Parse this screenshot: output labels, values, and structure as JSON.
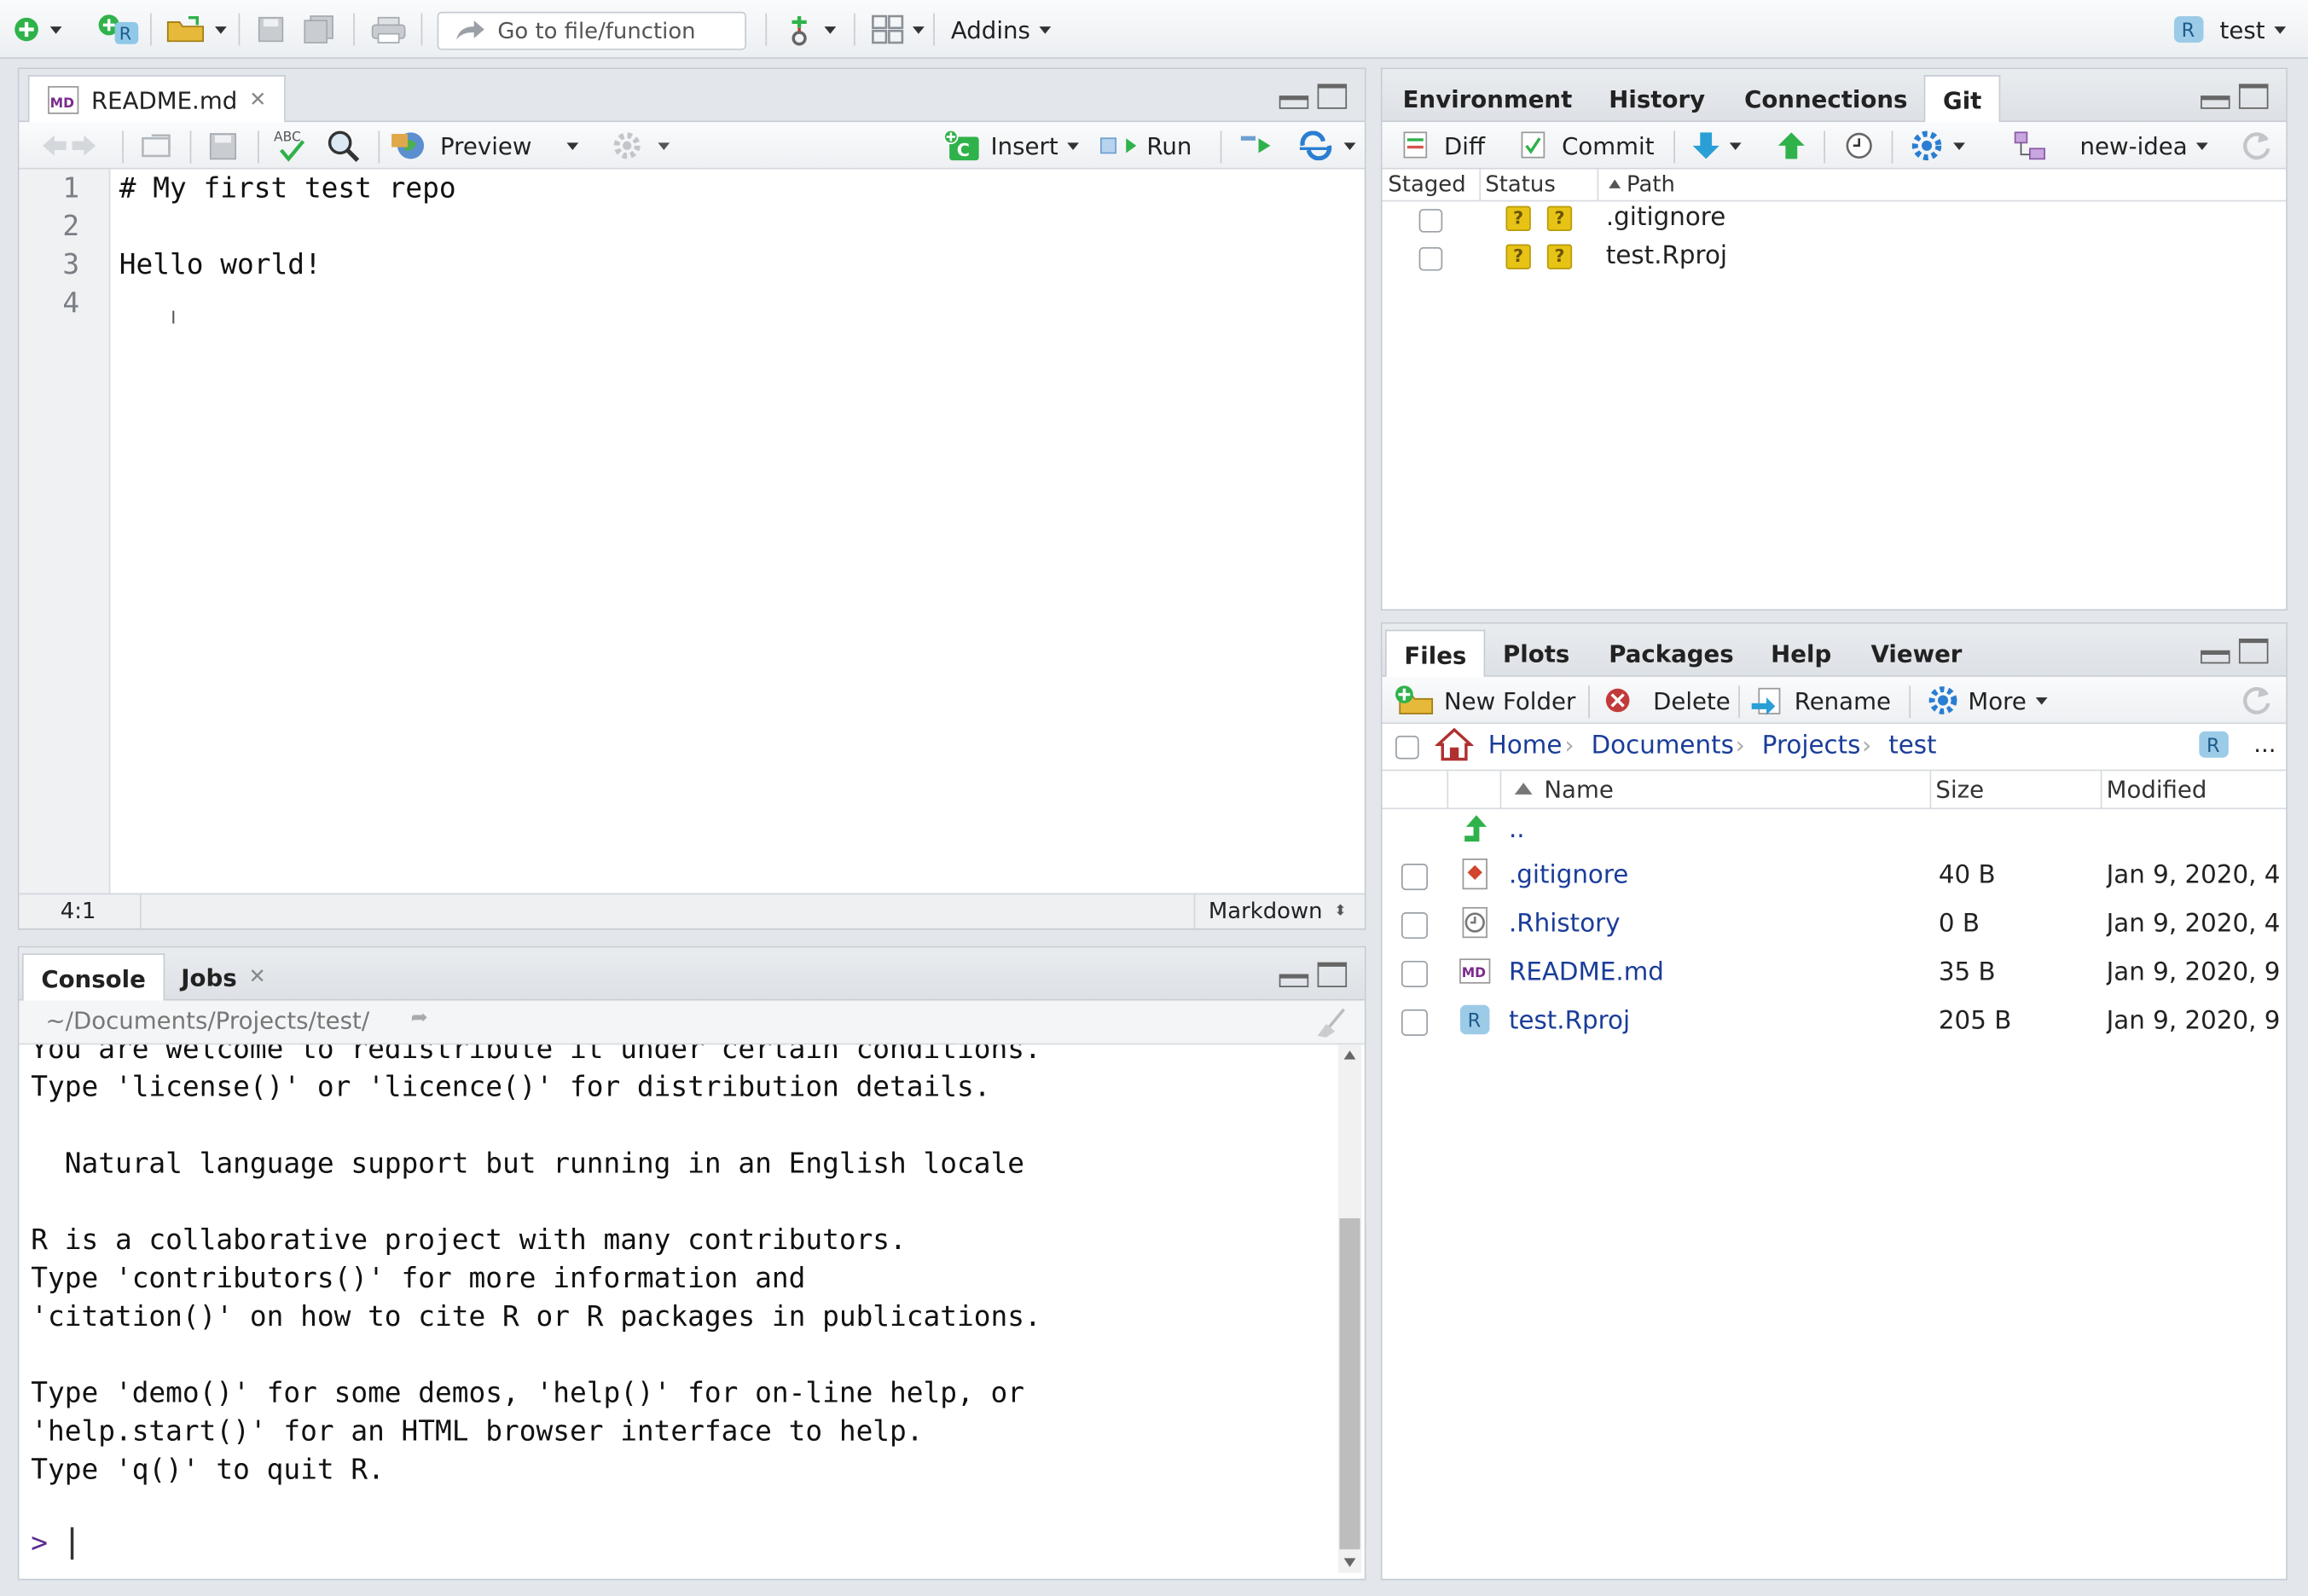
{
  "toolbar": {
    "goto_placeholder": "Go to file/function",
    "addins_label": "Addins",
    "project_label": "test"
  },
  "editor": {
    "tab_label": "README.md",
    "tab_icon": "markdown-file-icon",
    "preview_label": "Preview",
    "insert_label": "Insert",
    "run_label": "Run",
    "lines": [
      {
        "num": "1",
        "text": "# My first test repo"
      },
      {
        "num": "2",
        "text": ""
      },
      {
        "num": "3",
        "text": "Hello world!"
      },
      {
        "num": "4",
        "text": ""
      }
    ],
    "cursor_pos": "4:1",
    "mode": "Markdown"
  },
  "console": {
    "tabs": [
      "Console",
      "Jobs"
    ],
    "path": "~/Documents/Projects/test/",
    "lines": [
      "You are welcome to redistribute it under certain conditions.",
      "Type 'license()' or 'licence()' for distribution details.",
      "",
      "  Natural language support but running in an English locale",
      "",
      "R is a collaborative project with many contributors.",
      "Type 'contributors()' for more information and",
      "'citation()' on how to cite R or R packages in publications.",
      "",
      "Type 'demo()' for some demos, 'help()' for on-line help, or",
      "'help.start()' for an HTML browser interface to help.",
      "Type 'q()' to quit R."
    ],
    "prompt": ">"
  },
  "env_pane": {
    "tabs": [
      "Environment",
      "History",
      "Connections",
      "Git"
    ],
    "active_tab": "Git",
    "diff_label": "Diff",
    "commit_label": "Commit",
    "branch_label": "new-idea",
    "columns": [
      "Staged",
      "Status",
      "Path"
    ],
    "files": [
      {
        "path": ".gitignore",
        "status1": "?",
        "status2": "?"
      },
      {
        "path": "test.Rproj",
        "status1": "?",
        "status2": "?"
      }
    ]
  },
  "files_pane": {
    "tabs": [
      "Files",
      "Plots",
      "Packages",
      "Help",
      "Viewer"
    ],
    "active_tab": "Files",
    "new_folder_label": "New Folder",
    "delete_label": "Delete",
    "rename_label": "Rename",
    "more_label": "More",
    "breadcrumb": [
      "Home",
      "Documents",
      "Projects",
      "test"
    ],
    "ellipsis": "...",
    "columns": [
      "Name",
      "Size",
      "Modified"
    ],
    "up_label": "..",
    "rows": [
      {
        "name": ".gitignore",
        "size": "40 B",
        "modified": "Jan 9, 2020, 4",
        "icon": "git-file-icon"
      },
      {
        "name": ".Rhistory",
        "size": "0 B",
        "modified": "Jan 9, 2020, 4",
        "icon": "history-file-icon"
      },
      {
        "name": "README.md",
        "size": "35 B",
        "modified": "Jan 9, 2020, 9",
        "icon": "markdown-file-icon"
      },
      {
        "name": "test.Rproj",
        "size": "205 B",
        "modified": "Jan 9, 2020, 9",
        "icon": "rproj-file-icon"
      }
    ]
  },
  "colors": {
    "link": "#1a3d9a",
    "badge": "#e6c315",
    "green": "#2fb24a"
  }
}
